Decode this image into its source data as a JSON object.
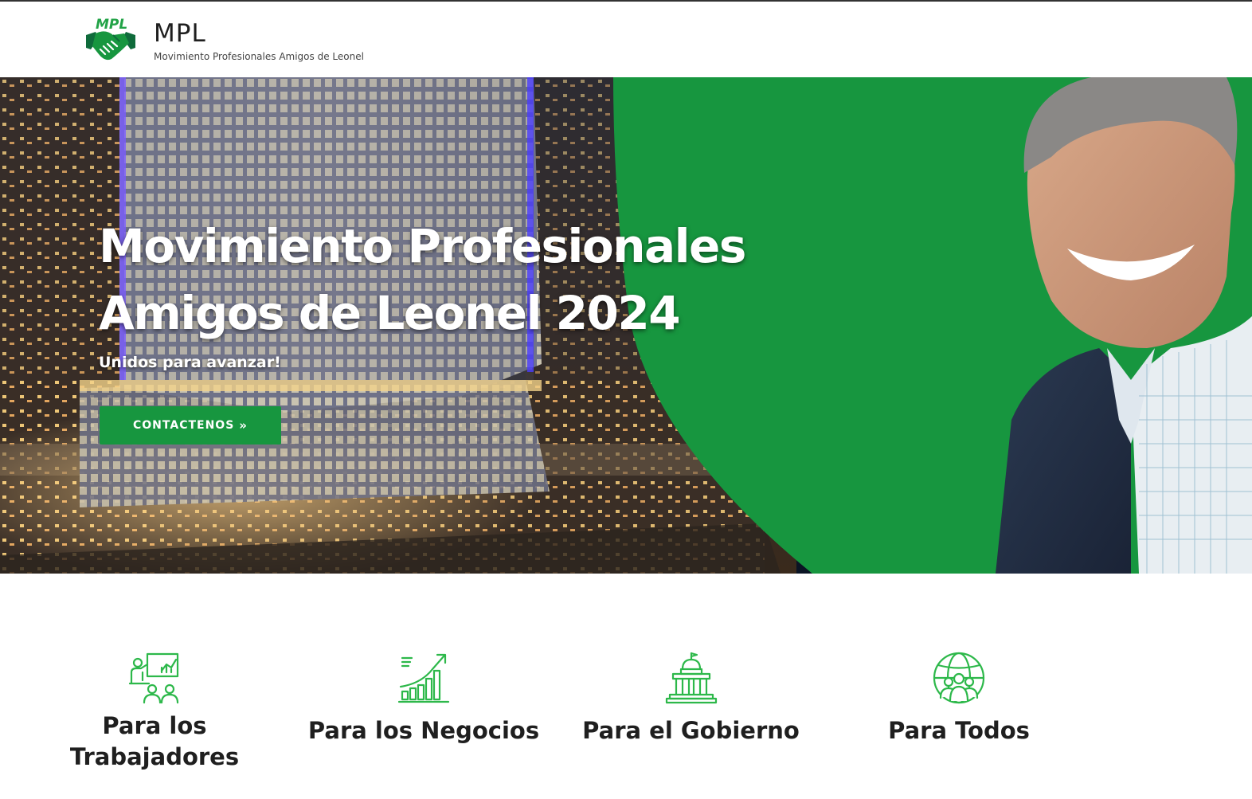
{
  "header": {
    "brand_name": "MPL",
    "brand_tagline": "Movimiento Profesionales Amigos de Leonel",
    "logo_text": "MPL",
    "logo_icon": "handshake-icon"
  },
  "hero": {
    "title": "Movimiento Profesionales Amigos de Leonel 2024",
    "subtitle": "Unidos para avanzar!",
    "cta_label": "CONTACTENOS",
    "cta_icon": "double-chevron-right-icon"
  },
  "features": [
    {
      "label": "Para los Trabajadores",
      "icon": "presentation-team-icon"
    },
    {
      "label": "Para los Negocios",
      "icon": "growth-chart-icon"
    },
    {
      "label": "Para el Gobierno",
      "icon": "government-building-icon"
    },
    {
      "label": "Para Todos",
      "icon": "global-community-icon"
    }
  ],
  "colors": {
    "brand_green": "#17963f",
    "logo_dark_green": "#0f6b3b",
    "icon_green": "#2db84a",
    "text_dark": "#1f1f1f"
  }
}
